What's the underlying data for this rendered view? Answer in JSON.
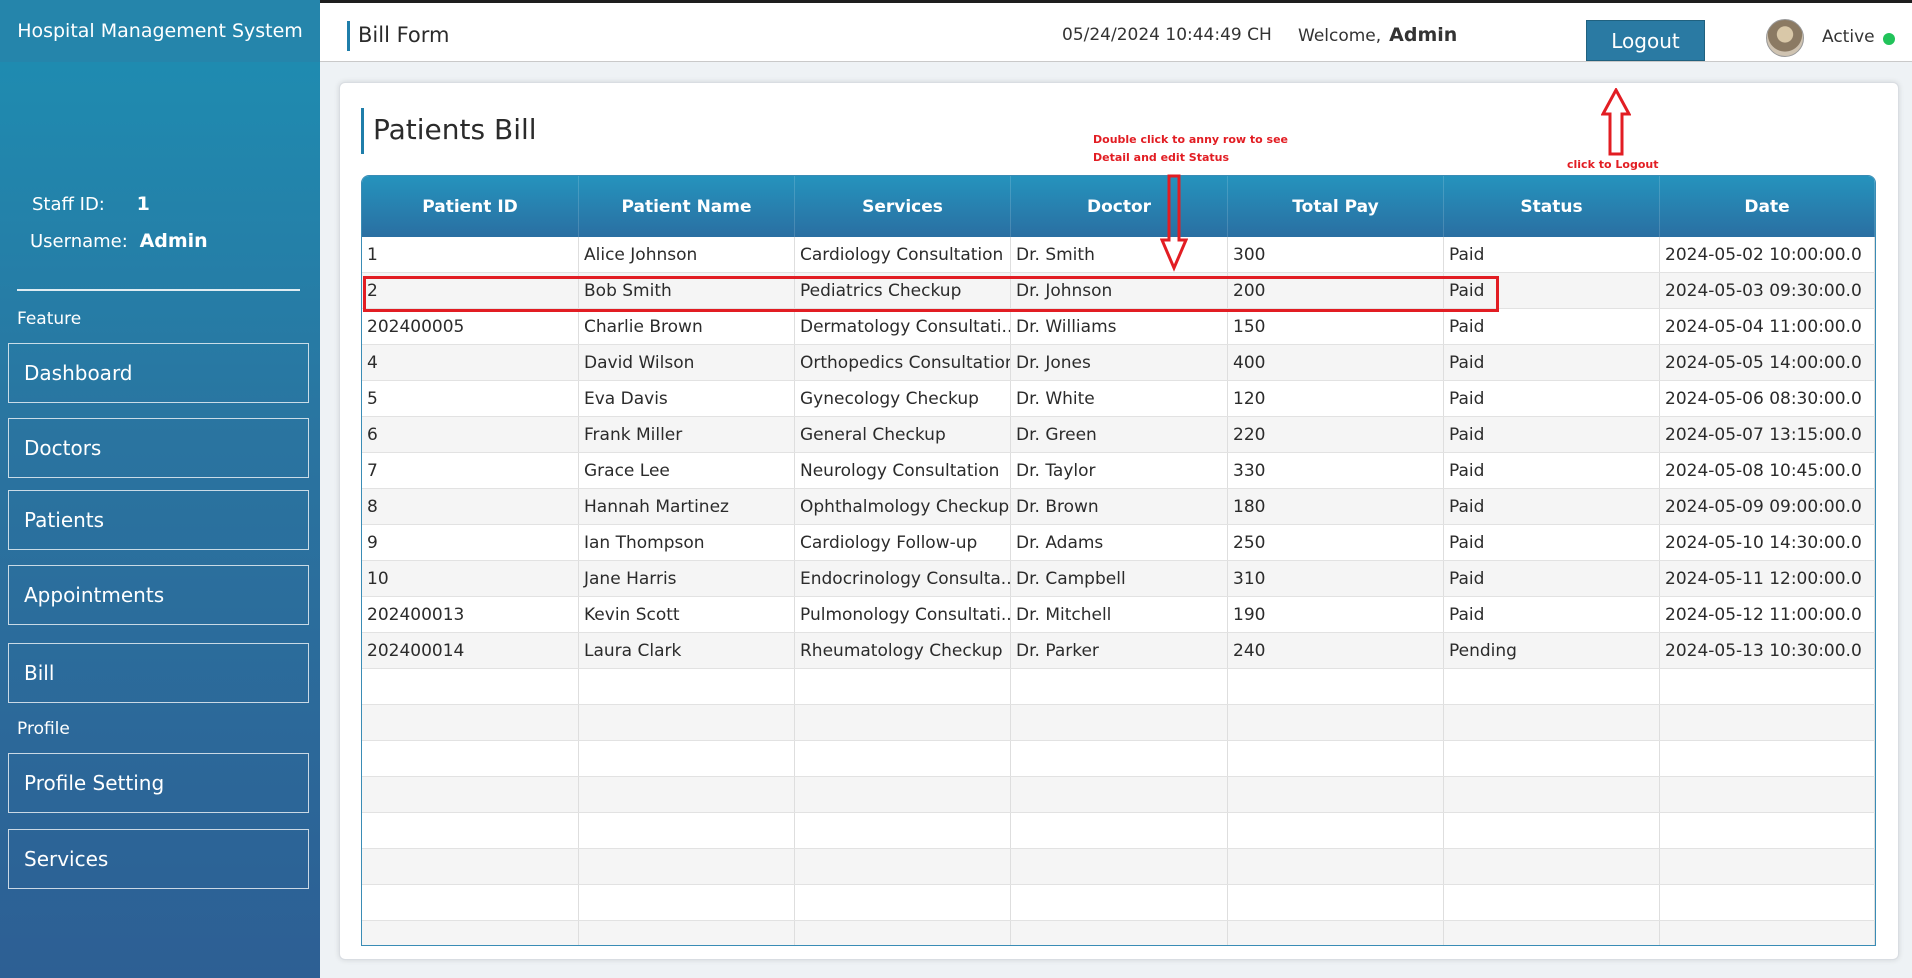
{
  "sidebar": {
    "brand": "Hospital Management System",
    "staff_id_label": "Staff ID:",
    "staff_id_value": "1",
    "username_label": "Username:",
    "username_value": "Admin",
    "feature_section": "Feature",
    "profile_section": "Profile",
    "nav": {
      "dashboard": "Dashboard",
      "doctors": "Doctors",
      "patients": "Patients",
      "appointments": "Appointments",
      "bill": "Bill",
      "profile_setting": "Profile Setting",
      "services": "Services"
    }
  },
  "header": {
    "title": "Bill Form",
    "datetime": "05/24/2024 10:44:49 CH",
    "welcome_label": "Welcome,",
    "welcome_user": "Admin",
    "logout_label": "Logout",
    "status_label": "Active",
    "status_color": "#21c35a"
  },
  "main": {
    "title": "Patients Bill",
    "columns": [
      "Patient ID",
      "Patient Name",
      "Services",
      "Doctor",
      "Total Pay",
      "Status",
      "Date"
    ],
    "rows": [
      [
        "1",
        "Alice Johnson",
        "Cardiology Consultation",
        "Dr. Smith",
        "300",
        "Paid",
        "2024-05-02 10:00:00.0"
      ],
      [
        "2",
        "Bob Smith",
        "Pediatrics Checkup",
        "Dr. Johnson",
        "200",
        "Paid",
        "2024-05-03 09:30:00.0"
      ],
      [
        "202400005",
        "Charlie Brown",
        "Dermatology Consultati...",
        "Dr. Williams",
        "150",
        "Paid",
        "2024-05-04 11:00:00.0"
      ],
      [
        "4",
        "David Wilson",
        "Orthopedics Consultation",
        "Dr. Jones",
        "400",
        "Paid",
        "2024-05-05 14:00:00.0"
      ],
      [
        "5",
        "Eva Davis",
        "Gynecology Checkup",
        "Dr. White",
        "120",
        "Paid",
        "2024-05-06 08:30:00.0"
      ],
      [
        "6",
        "Frank Miller",
        "General Checkup",
        "Dr. Green",
        "220",
        "Paid",
        "2024-05-07 13:15:00.0"
      ],
      [
        "7",
        "Grace Lee",
        "Neurology Consultation",
        "Dr. Taylor",
        "330",
        "Paid",
        "2024-05-08 10:45:00.0"
      ],
      [
        "8",
        "Hannah Martinez",
        "Ophthalmology Checkup",
        "Dr. Brown",
        "180",
        "Paid",
        "2024-05-09 09:00:00.0"
      ],
      [
        "9",
        "Ian Thompson",
        "Cardiology Follow-up",
        "Dr. Adams",
        "250",
        "Paid",
        "2024-05-10 14:30:00.0"
      ],
      [
        "10",
        "Jane Harris",
        "Endocrinology Consulta...",
        "Dr. Campbell",
        "310",
        "Paid",
        "2024-05-11 12:00:00.0"
      ],
      [
        "202400013",
        "Kevin Scott",
        "Pulmonology Consultati...",
        "Dr. Mitchell",
        "190",
        "Paid",
        "2024-05-12 11:00:00.0"
      ],
      [
        "202400014",
        "Laura Clark",
        "Rheumatology Checkup",
        "Dr. Parker",
        "240",
        "Pending",
        "2024-05-13 10:30:00.0"
      ]
    ],
    "empty_rows": 8
  },
  "annotations": {
    "row_hint_line1": "Double click to anny row to see",
    "row_hint_line2": "Detail and edit Status",
    "logout_hint": "click to Logout",
    "color": "#e21d23"
  }
}
